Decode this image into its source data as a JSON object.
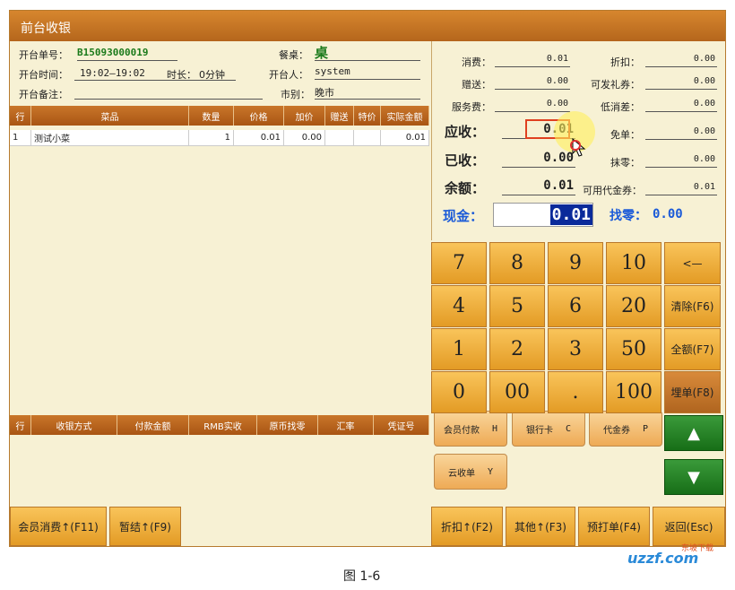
{
  "window": {
    "title": "前台收银"
  },
  "order": {
    "no_label": "开台单号：",
    "no_value": "B15093000019",
    "table_label": "餐桌：",
    "table_value": "桌",
    "time_label": "开台时间：",
    "time_value": "19:02—19:02",
    "duration_label": "时长：",
    "duration_value": "0分钟",
    "opener_label": "开台人：",
    "opener_value": "system",
    "remark_label": "开台备注：",
    "remark_value": "",
    "market_label": "市别：",
    "market_value": "晚市"
  },
  "items_table": {
    "headers": [
      "行",
      "菜品",
      "数量",
      "价格",
      "加价",
      "赠送",
      "特价",
      "实际金额"
    ],
    "rows": [
      [
        "1",
        "测试小菜",
        "1",
        "0.01",
        "0.00",
        "",
        "",
        "0.01"
      ]
    ]
  },
  "payment_table": {
    "headers": [
      "行",
      "收银方式",
      "付款金额",
      "RMB实收",
      "原币找零",
      "汇率",
      "凭证号"
    ]
  },
  "summary": {
    "consume_label": "消费：",
    "consume": "0.01",
    "discount_label": "折扣：",
    "discount": "0.00",
    "gift_label": "赠送：",
    "gift": "0.00",
    "coupon_gift_label": "可发礼券：",
    "coupon_gift": "0.00",
    "service_label": "服务费：",
    "service": "0.00",
    "low_label": "低消差：",
    "low": "0.00",
    "receivable_label": "应收：",
    "receivable": "0.01",
    "free_label": "免单：",
    "free": "0.00",
    "received_label": "已收：",
    "received": "0.00",
    "rounding_label": "抹零：",
    "rounding": "0.00",
    "balance_label": "余额：",
    "balance": "0.01",
    "voucher_label": "可用代金券：",
    "voucher": "0.01",
    "cash_label": "现金：",
    "cash": "0.01",
    "change_label": "找零：",
    "change": "0.00"
  },
  "keypad": {
    "keys": [
      "7",
      "8",
      "9",
      "10",
      "<—",
      "4",
      "5",
      "6",
      "20",
      "清除(F6)",
      "1",
      "2",
      "3",
      "50",
      "全额(F7)",
      "0",
      "00",
      ".",
      "100",
      "埋单(F8)"
    ]
  },
  "pay_methods": [
    {
      "label": "会员付款",
      "hotkey": "H"
    },
    {
      "label": "银行卡",
      "hotkey": "C"
    },
    {
      "label": "代金券",
      "hotkey": "P"
    },
    {
      "label": "云收单",
      "hotkey": "Y"
    }
  ],
  "arrows": {
    "up": "▲",
    "down": "▼"
  },
  "bottom_left": [
    "会员消费↑(F11)",
    "暂结↑(F9)"
  ],
  "bottom_right": [
    "折扣↑(F2)",
    "其他↑(F3)",
    "预打单(F4)",
    "返回(Esc)"
  ],
  "caption": "图 1-6",
  "watermark": {
    "main": "uzzf.com",
    "sub": "东坡下载"
  }
}
